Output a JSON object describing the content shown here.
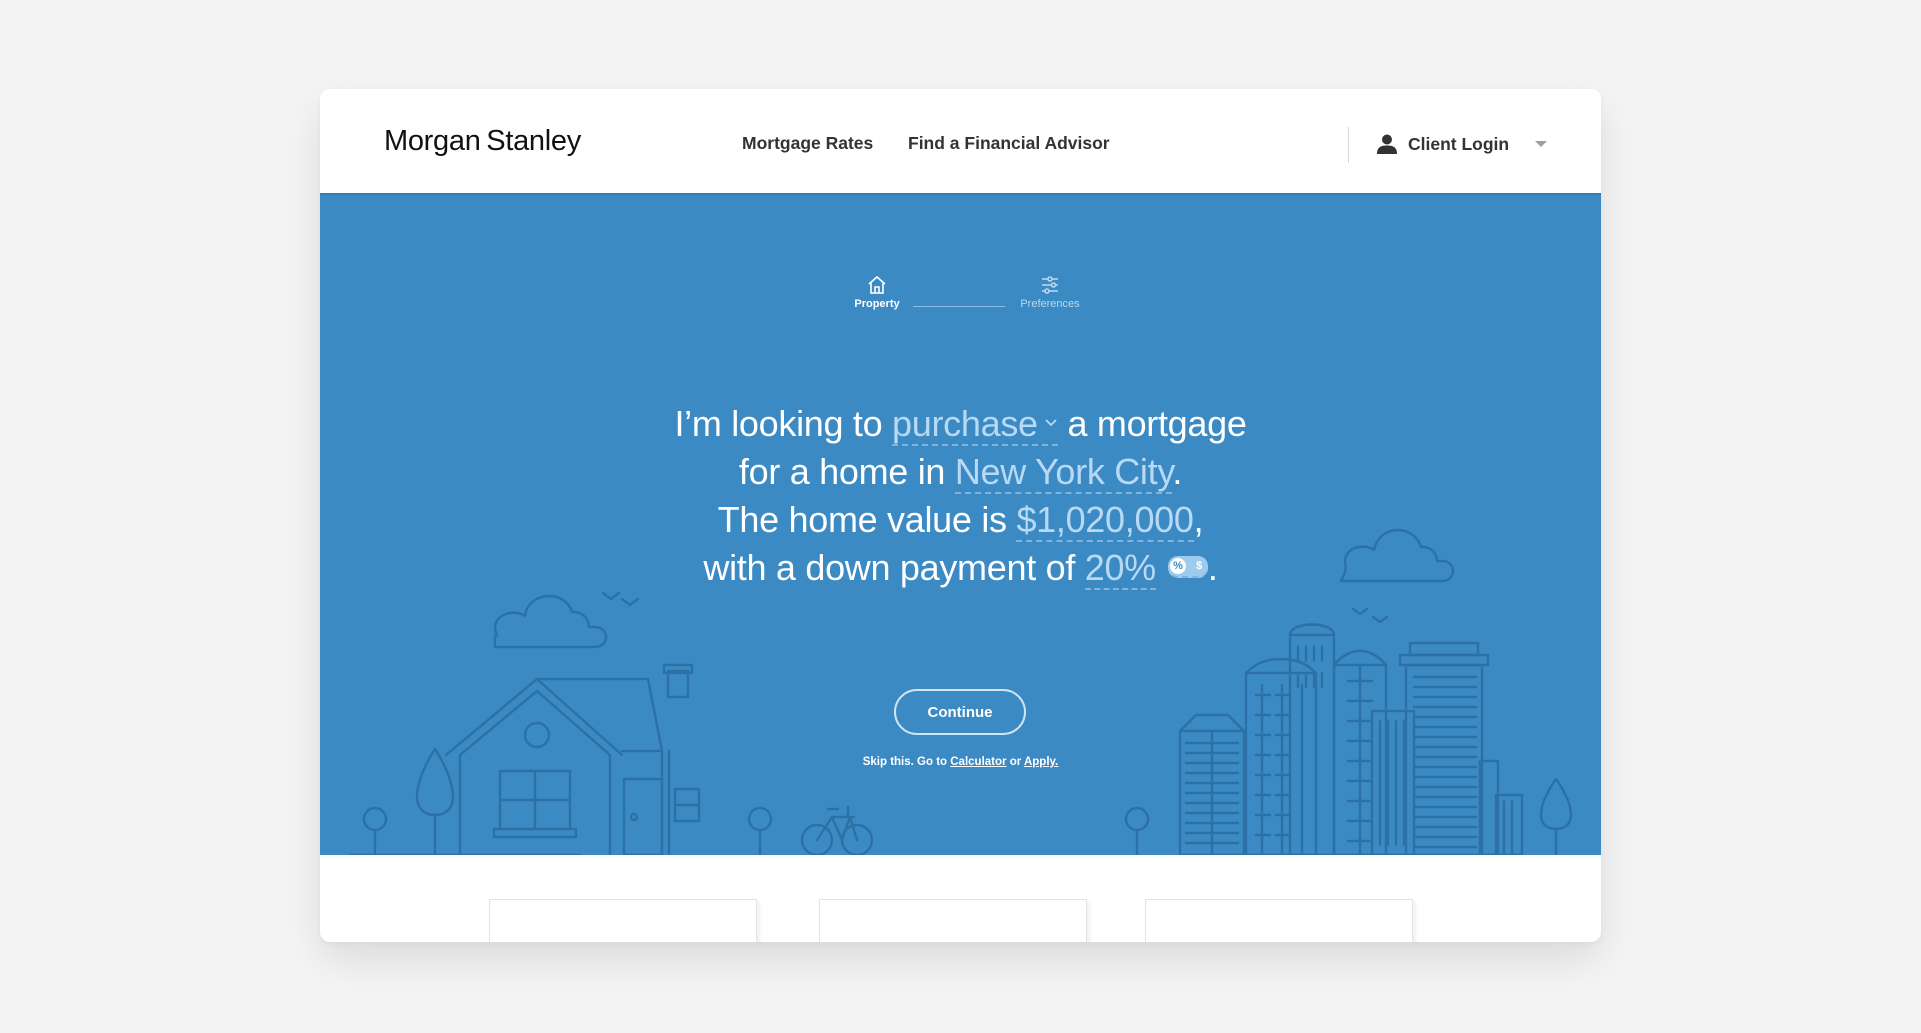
{
  "header": {
    "logo": "Morgan Stanley",
    "nav": [
      "Mortgage Rates",
      "Find a Financial Advisor"
    ],
    "login_label": "Client Login",
    "icons": {
      "user": "user-icon",
      "caret": "caret-down-icon"
    }
  },
  "steps": [
    {
      "label": "Property",
      "icon": "home-icon",
      "active": true
    },
    {
      "label": "Preferences",
      "icon": "sliders-icon",
      "active": false
    }
  ],
  "sentence": {
    "line1_pre": "I’m looking to ",
    "purpose": "purchase",
    "line1_post": " a mortgage",
    "line2_pre": "for a home in ",
    "location": "New York City",
    "line2_post": ".",
    "line3_pre": "The home value is ",
    "home_value": "$1,020,000",
    "line3_post": ",",
    "line4_pre": "with a down payment of ",
    "down_payment": "20%",
    "line4_post": ".",
    "toggle": {
      "active": "%",
      "inactive": "$"
    }
  },
  "actions": {
    "continue_label": "Continue",
    "skip_pre": "Skip this. Go to ",
    "calculator_link": "Calculator",
    "skip_mid": " or ",
    "apply_link": "Apply."
  },
  "colors": {
    "hero_bg": "#3c8ac3",
    "field_text": "#b8d9f3",
    "header_border": "#2f7cb9",
    "page_bg": "#f4f4f4"
  }
}
